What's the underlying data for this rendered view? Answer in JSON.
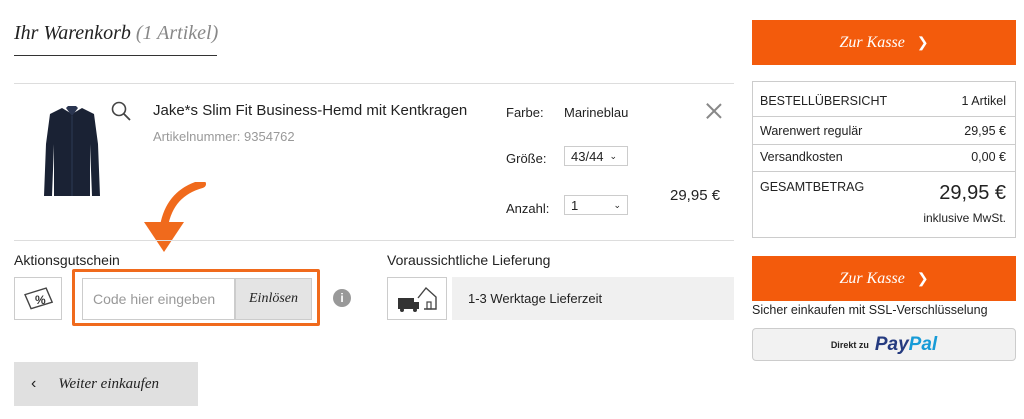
{
  "cart": {
    "title": "Ihr Warenkorb",
    "count": "(1 Artikel)"
  },
  "product": {
    "name": "Jake*s Slim Fit Business-Hemd mit Kentkragen",
    "article_number": "Artikelnummer: 9354762",
    "color_label": "Farbe:",
    "color_value": "Marineblau",
    "size_label": "Größe:",
    "size_value": "43/44",
    "qty_label": "Anzahl:",
    "qty_value": "1",
    "price": "29,95 €"
  },
  "voucher": {
    "heading": "Aktionsgutschein",
    "placeholder": "Code hier eingeben",
    "redeem_label": "Einlösen",
    "info": "i"
  },
  "delivery": {
    "heading": "Voraussichtliche Lieferung",
    "text": "1-3 Werktage Lieferzeit"
  },
  "continue_label": "Weiter einkaufen",
  "checkout_label": "Zur Kasse",
  "summary": {
    "heading": "BESTELLÜBERSICHT",
    "count": "1 Artikel",
    "rows": [
      {
        "label": "Warenwert regulär",
        "value": "29,95 €"
      },
      {
        "label": "Versandkosten",
        "value": "0,00 €"
      }
    ],
    "total_label": "GESAMTBETRAG",
    "total_value": "29,95 €",
    "vat_note": "inklusive MwSt."
  },
  "ssl_text": "Sicher einkaufen mit SSL-Verschlüsselung",
  "paypal": {
    "prefix": "Direkt zu",
    "brand_pay": "Pay",
    "brand_pal": "Pal"
  },
  "colors": {
    "accent": "#f35b0c",
    "paypal_dark": "#253b80",
    "paypal_light": "#179bd7"
  },
  "icons": [
    "zoom-icon",
    "close-icon",
    "voucher-percent-icon",
    "info-icon",
    "delivery-truck-icon",
    "chevron-right-icon",
    "chevron-left-icon",
    "arrow-down-icon"
  ]
}
